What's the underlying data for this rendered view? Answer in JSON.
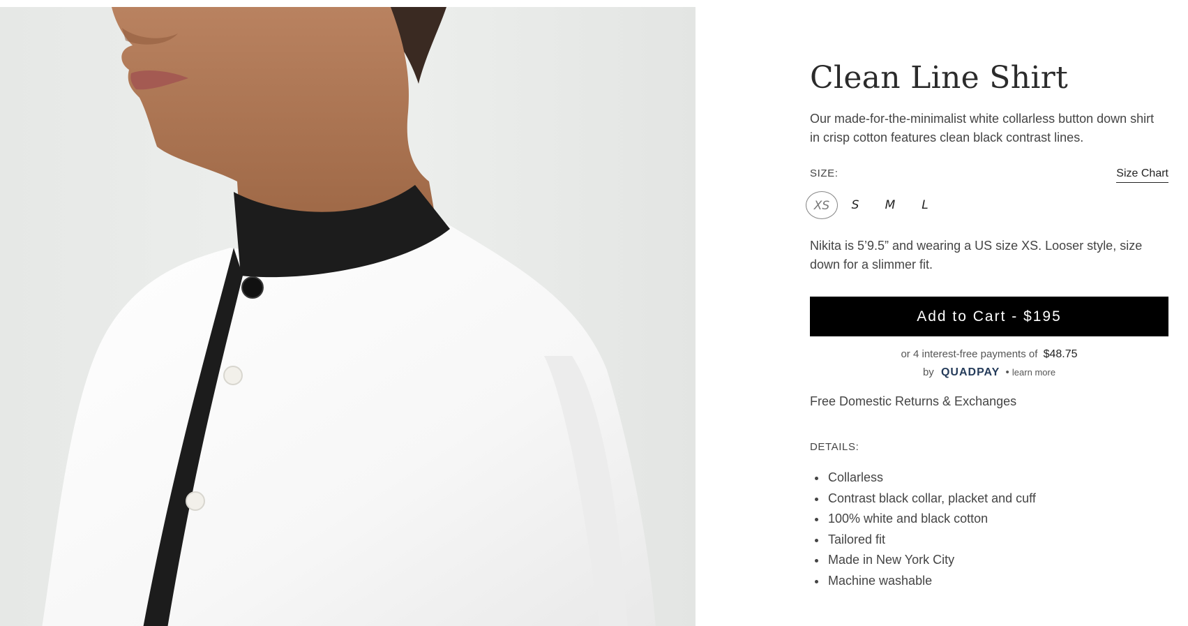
{
  "product": {
    "title": "Clean Line Shirt",
    "description": "Our made-for-the-minimalist white collarless button down shirt in crisp cotton features clean black contrast lines.",
    "image_alt": "Model wearing white collarless shirt with black collar and placket"
  },
  "size": {
    "label": "SIZE:",
    "chart_link": "Size Chart",
    "options": [
      "XS",
      "S",
      "M",
      "L"
    ],
    "selected": "XS"
  },
  "fit_note": "Nikita is 5’9.5” and wearing a US size XS. Looser style, size down for a slimmer fit.",
  "cart": {
    "button_label": "Add to Cart - $195"
  },
  "quadpay": {
    "line1_text": "or 4 interest-free payments of",
    "amount": "$48.75",
    "by": "by",
    "brand": "QUADPAY",
    "separator": "•",
    "learn_more": "learn more"
  },
  "returns": "Free Domestic Returns & Exchanges",
  "details": {
    "label": "DETAILS:",
    "items": [
      "Collarless",
      "Contrast black collar, placket and cuff",
      "100% white and black cotton",
      "Tailored fit",
      "Made in New York City",
      "Machine washable"
    ]
  },
  "colors": {
    "button_bg": "#000000",
    "button_text": "#ffffff",
    "quadpay_brand": "#243b5a",
    "shirt_white": "#fbfbfb",
    "collar_black": "#1c1c1c",
    "skin": "#b27c58"
  }
}
